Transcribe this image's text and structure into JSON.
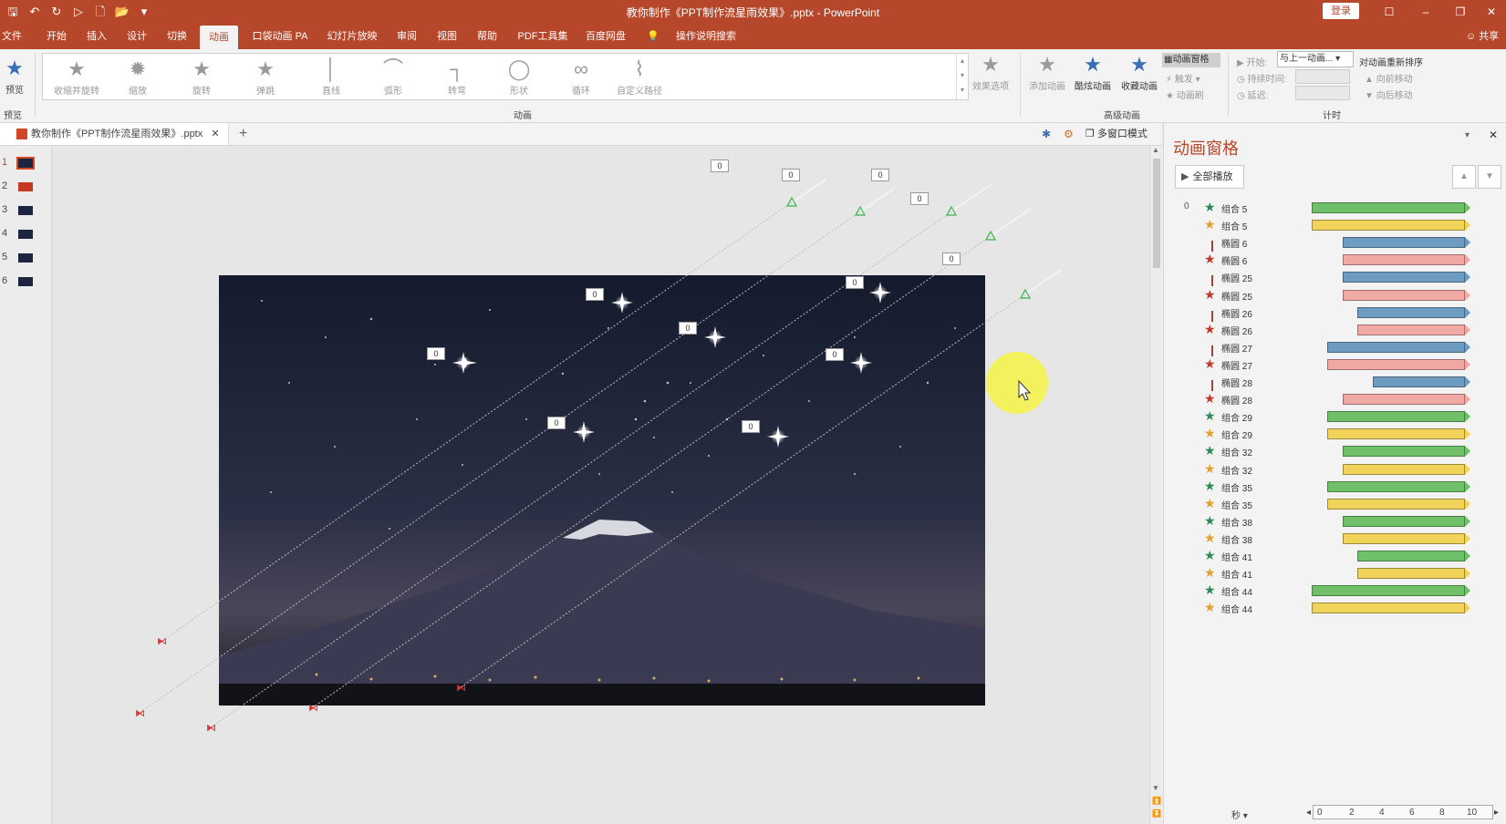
{
  "window": {
    "title": "教你制作《PPT制作流星雨效果》.pptx - PowerPoint",
    "login_label": "登录",
    "share_label": "共享"
  },
  "tabs": [
    "文件",
    "开始",
    "插入",
    "设计",
    "切换",
    "动画",
    "口袋动画 PA",
    "幻灯片放映",
    "审阅",
    "视图",
    "帮助",
    "PDF工具集",
    "百度网盘",
    "操作说明搜索"
  ],
  "active_tab": "动画",
  "ribbon": {
    "preview_label": "预览",
    "preview_group": "预览",
    "gallery": [
      "收缩并旋转",
      "缩放",
      "旋转",
      "弹跳",
      "直线",
      "弧形",
      "转弯",
      "形状",
      "循环",
      "自定义路径"
    ],
    "effect_options": "效果选项",
    "animation_group": "动画",
    "add_animation": "添加动画",
    "cool_animation": "酷炫动画",
    "collect_animation": "收藏动画",
    "animation_pane_btn": "动画窗格",
    "trigger": "触发",
    "anim_painter": "动画刷",
    "advanced_group": "高级动画",
    "start_label": "开始:",
    "start_value": "与上一动画...",
    "duration_label": "持续时间:",
    "delay_label": "延迟:",
    "reorder_title": "对动画重新排序",
    "move_earlier": "向前移动",
    "move_later": "向后移动",
    "timing_group": "计时"
  },
  "doc_tab": "教你制作《PPT制作流星雨效果》.pptx",
  "multi_window": "多窗口模式",
  "slides": [
    "1",
    "2",
    "3",
    "4",
    "5",
    "6"
  ],
  "tags": [
    "0",
    "0",
    "0",
    "0",
    "0",
    "0",
    "0",
    "0",
    "0",
    "0",
    "0",
    "0",
    "0"
  ],
  "pane": {
    "title": "动画窗格",
    "play_all": "全部播放",
    "first_number": "0",
    "items": [
      {
        "name": "组合 5",
        "star": "#2e8b57",
        "kind": "star",
        "bar": "#6fc068",
        "start": 0.0,
        "end": 1.0
      },
      {
        "name": "组合 5",
        "star": "#e0a030",
        "kind": "star",
        "bar": "#f2d35a",
        "start": 0.0,
        "end": 1.0
      },
      {
        "name": "椭圆 6",
        "star": "#a04040",
        "kind": "path",
        "bar": "#6e9cc0",
        "start": 0.2,
        "end": 1.0
      },
      {
        "name": "椭圆 6",
        "star": "#c0392b",
        "kind": "star",
        "bar": "#f1a9a6",
        "start": 0.2,
        "end": 1.0
      },
      {
        "name": "椭圆 25",
        "star": "#a04040",
        "kind": "path",
        "bar": "#6e9cc0",
        "start": 0.2,
        "end": 1.0
      },
      {
        "name": "椭圆 25",
        "star": "#c0392b",
        "kind": "star",
        "bar": "#f1a9a6",
        "start": 0.2,
        "end": 1.0
      },
      {
        "name": "椭圆 26",
        "star": "#a04040",
        "kind": "path",
        "bar": "#6e9cc0",
        "start": 0.3,
        "end": 1.0
      },
      {
        "name": "椭圆 26",
        "star": "#c0392b",
        "kind": "star",
        "bar": "#f1a9a6",
        "start": 0.3,
        "end": 1.0
      },
      {
        "name": "椭圆 27",
        "star": "#a04040",
        "kind": "path",
        "bar": "#6e9cc0",
        "start": 0.1,
        "end": 1.0
      },
      {
        "name": "椭圆 27",
        "star": "#c0392b",
        "kind": "star",
        "bar": "#f1a9a6",
        "start": 0.1,
        "end": 1.0
      },
      {
        "name": "椭圆 28",
        "star": "#a04040",
        "kind": "path",
        "bar": "#6e9cc0",
        "start": 0.4,
        "end": 1.0
      },
      {
        "name": "椭圆 28",
        "star": "#c0392b",
        "kind": "star",
        "bar": "#f1a9a6",
        "start": 0.2,
        "end": 1.0
      },
      {
        "name": "组合 29",
        "star": "#2e8b57",
        "kind": "star",
        "bar": "#6fc068",
        "start": 0.1,
        "end": 1.0
      },
      {
        "name": "组合 29",
        "star": "#e0a030",
        "kind": "star",
        "bar": "#f2d35a",
        "start": 0.1,
        "end": 1.0
      },
      {
        "name": "组合 32",
        "star": "#2e8b57",
        "kind": "star",
        "bar": "#6fc068",
        "start": 0.2,
        "end": 1.0
      },
      {
        "name": "组合 32",
        "star": "#e0a030",
        "kind": "star",
        "bar": "#f2d35a",
        "start": 0.2,
        "end": 1.0
      },
      {
        "name": "组合 35",
        "star": "#2e8b57",
        "kind": "star",
        "bar": "#6fc068",
        "start": 0.1,
        "end": 1.0
      },
      {
        "name": "组合 35",
        "star": "#e0a030",
        "kind": "star",
        "bar": "#f2d35a",
        "start": 0.1,
        "end": 1.0
      },
      {
        "name": "组合 38",
        "star": "#2e8b57",
        "kind": "star",
        "bar": "#6fc068",
        "start": 0.2,
        "end": 1.0
      },
      {
        "name": "组合 38",
        "star": "#e0a030",
        "kind": "star",
        "bar": "#f2d35a",
        "start": 0.2,
        "end": 1.0
      },
      {
        "name": "组合 41",
        "star": "#2e8b57",
        "kind": "star",
        "bar": "#6fc068",
        "start": 0.3,
        "end": 1.0
      },
      {
        "name": "组合 41",
        "star": "#e0a030",
        "kind": "star",
        "bar": "#f2d35a",
        "start": 0.3,
        "end": 1.0
      },
      {
        "name": "组合 44",
        "star": "#2e8b57",
        "kind": "star",
        "bar": "#6fc068",
        "start": 0.0,
        "end": 1.0
      },
      {
        "name": "组合 44",
        "star": "#e0a030",
        "kind": "star",
        "bar": "#f2d35a",
        "start": 0.0,
        "end": 1.0
      }
    ],
    "timeline_unit": "秒",
    "timeline_ticks": [
      "0",
      "2",
      "4",
      "6",
      "8",
      "10"
    ]
  },
  "colors": {
    "brand": "#b7472a",
    "ribbon_bg": "#f3f3f3",
    "canvas_bg": "#e6e6e6"
  }
}
